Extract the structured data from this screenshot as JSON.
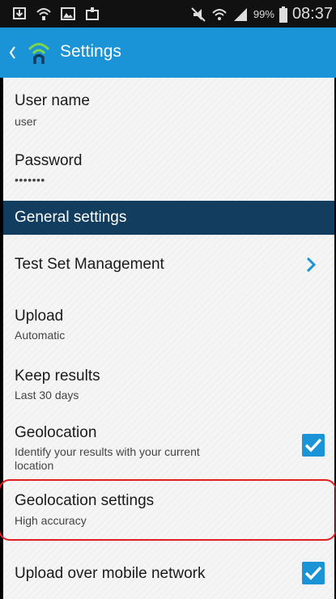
{
  "status_bar": {
    "icons_left": [
      "download-notification-icon",
      "wifi-notification-icon",
      "gallery-icon",
      "cast-icon"
    ],
    "icons_right": [
      "mute-vibrate-icon",
      "wifi-icon",
      "cell-signal-icon"
    ],
    "battery_percent": "99%",
    "time": "08:37"
  },
  "header": {
    "title": "Settings",
    "accent_color": "#1a94d6"
  },
  "settings": {
    "username": {
      "title": "User name",
      "value": "user"
    },
    "password": {
      "title": "Password",
      "value": "•••••••"
    },
    "section_general": "General settings",
    "test_set": {
      "title": "Test Set Management"
    },
    "upload": {
      "title": "Upload",
      "value": "Automatic"
    },
    "keep_results": {
      "title": "Keep results",
      "value": "Last 30 days"
    },
    "geolocation": {
      "title": "Geolocation",
      "summary_line1": "Identify your results with your current",
      "summary_line2": "location",
      "checked": true
    },
    "geolocation_settings": {
      "title": "Geolocation settings",
      "value": "High accuracy"
    },
    "upload_mobile": {
      "title": "Upload over mobile network",
      "checked": true
    }
  },
  "colors": {
    "section_bg": "#123d5e",
    "checkbox": "#1a94d6",
    "highlight": "#e01e1e"
  }
}
